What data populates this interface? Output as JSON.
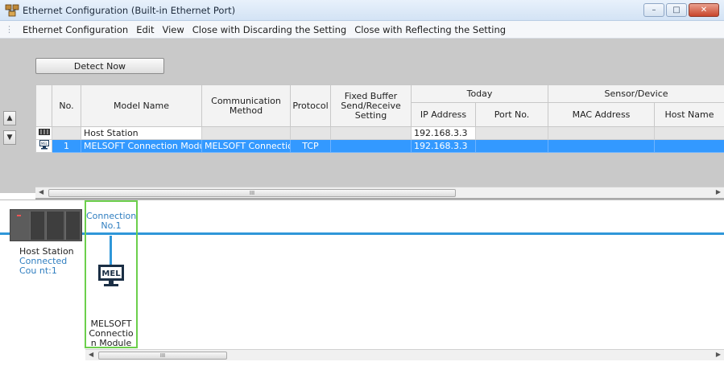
{
  "window": {
    "title": "Ethernet Configuration (Built-in Ethernet Port)",
    "controls": {
      "minimize": "–",
      "maximize": "□",
      "close": "✕"
    }
  },
  "menu": {
    "items": [
      "Ethernet Configuration",
      "Edit",
      "View",
      "Close with Discarding the Setting",
      "Close with Reflecting the Setting"
    ]
  },
  "toolbar": {
    "detect_now_label": "Detect Now"
  },
  "table": {
    "group_headers": {
      "today": "Today",
      "sensor_device": "Sensor/Device"
    },
    "columns": {
      "no": "No.",
      "model_name": "Model Name",
      "communication_method": "Communication Method",
      "protocol": "Protocol",
      "fixed_buffer": "Fixed Buffer Send/Receive Setting",
      "ip_address": "IP Address",
      "port_no": "Port No.",
      "mac_address": "MAC Address",
      "host_name": "Host Name"
    },
    "rows": [
      {
        "icon": "plc-icon",
        "no": "",
        "model_name": "Host Station",
        "communication_method": "",
        "protocol": "",
        "fixed_buffer": "",
        "ip_address": "192.168.3.3",
        "port_no": "",
        "mac_address": "",
        "host_name": ""
      },
      {
        "icon": "mel-monitor-icon",
        "no": "1",
        "model_name": "MELSOFT Connection Module",
        "communication_method": "MELSOFT Connection",
        "protocol": "TCP",
        "fixed_buffer": "",
        "ip_address": "192.168.3.3",
        "port_no": "",
        "mac_address": "",
        "host_name": "",
        "selected": true
      }
    ],
    "scroll_thumb_label": "III"
  },
  "diagram": {
    "host_station": {
      "name": "Host Station",
      "connected_count": "Connected Cou nt:1"
    },
    "connection": {
      "label": "Connection No.1"
    },
    "module": {
      "icon_text": "MEL",
      "name": "MELSOFT Connectio n Module"
    },
    "scroll_thumb_label": "III"
  },
  "colors": {
    "selection": "#3399ff",
    "connection_line": "#2f97d9",
    "connection_box": "#6ccf4c",
    "link_text": "#2f7ec0"
  }
}
